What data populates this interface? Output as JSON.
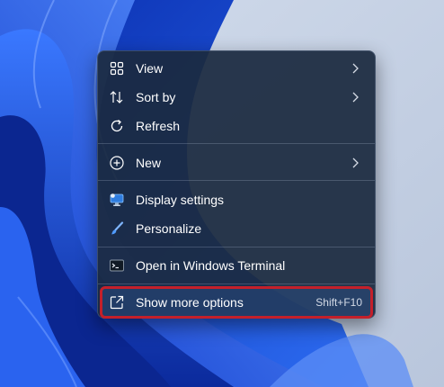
{
  "menu": {
    "items": [
      {
        "label": "View",
        "icon": "grid-view-icon"
      },
      {
        "label": "Sort by",
        "icon": "sort-arrows-icon"
      },
      {
        "label": "Refresh",
        "icon": "refresh-icon"
      },
      {
        "label": "New",
        "icon": "plus-circle-icon"
      },
      {
        "label": "Display settings",
        "icon": "monitor-icon"
      },
      {
        "label": "Personalize",
        "icon": "brush-icon"
      },
      {
        "label": "Open in Windows Terminal",
        "icon": "terminal-icon"
      },
      {
        "label": "Show more options",
        "shortcut": "Shift+F10",
        "icon": "open-external-icon"
      }
    ]
  },
  "colors": {
    "menu_background": "#1b2a40",
    "highlight_border": "#c4202a",
    "wallpaper_blue": "#1f4fd8",
    "accent": "#58a6ff"
  }
}
